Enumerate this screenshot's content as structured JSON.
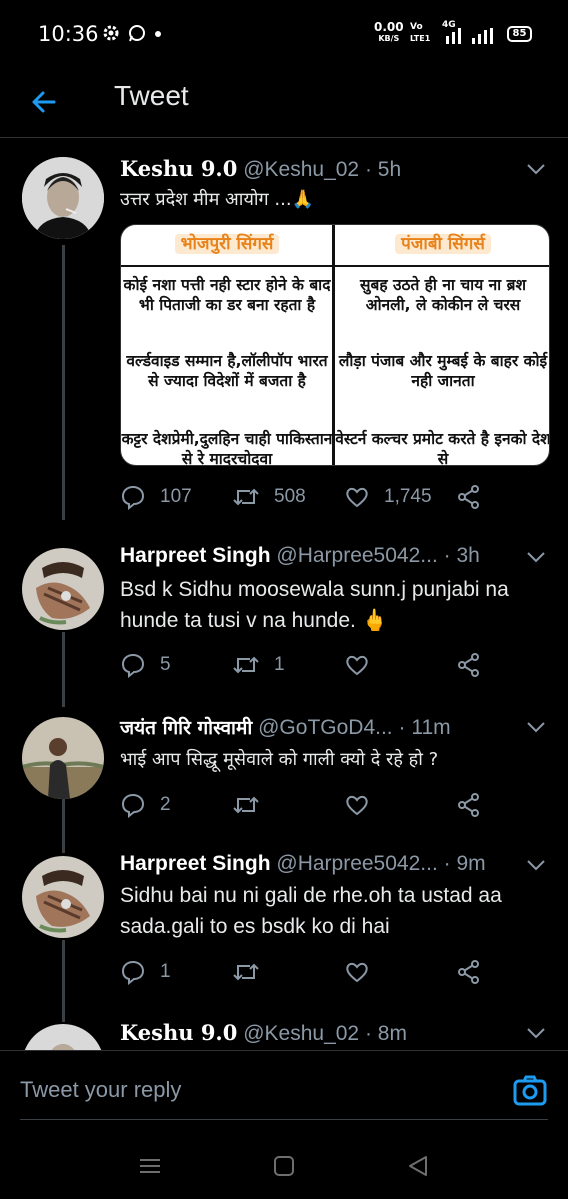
{
  "status_bar": {
    "time": "10:36",
    "net_speed_value": "0.00",
    "net_speed_unit": "KB/S",
    "volte_top": "Vo",
    "volte_bottom": "LTE1",
    "network_label": "4G",
    "battery": "85",
    "icons": [
      "gear-icon",
      "whatsapp-icon",
      "dot-icon",
      "signal-icon",
      "battery-icon"
    ]
  },
  "header": {
    "title": "Tweet",
    "back_icon": "arrow-left-icon"
  },
  "colors": {
    "accent": "#1d9bf0",
    "muted": "#8b98a5",
    "divider": "#2f3336",
    "background": "#000000"
  },
  "tweets": [
    {
      "name": "Keshu 9.0",
      "handle": "@Keshu_02",
      "sep": "·",
      "time": "5h",
      "text": "उत्तर प्रदेश मीम आयोग ...🙏",
      "media": {
        "left_title": "भोजपुरी सिंगर्स",
        "right_title": "पंजाबी सिंगर्स",
        "left_paragraphs": [
          "कोई नशा पत्ती नही स्टार होने के बाद भी पिताजी का डर बना रहता है",
          "वर्ल्डवाइड सम्मान है,लॉलीपॉप भारत से ज्यादा विदेशों में बजता है",
          "कट्टर देशप्रेमी,दुलहिन चाही पाकिस्तान से रे मादरचोदवा"
        ],
        "right_paragraphs": [
          "सुबह उठते ही ना चाय ना ब्रश ओनली, ले कोकीन ले चरस",
          "लौड़ा पंजाब और मुम्बई के बाहर कोई नही जानता",
          "वेस्टर्न कल्चर प्रमोट करते है इनको देश से"
        ]
      },
      "replies": "107",
      "retweets": "508",
      "likes": "1,745"
    },
    {
      "name": "Harpreet Singh",
      "handle": "@Harpree5042...",
      "sep": "·",
      "time": "3h",
      "text": "Bsd k Sidhu moosewala sunn.j punjabi na hunde ta tusi v na hunde. 🖕",
      "replies": "5",
      "retweets": "1",
      "likes": ""
    },
    {
      "name": "जयंत गिरि गोस्वामी",
      "handle": "@GoTGoD4...",
      "sep": "·",
      "time": "11m",
      "text": "भाई आप सिद्धू मूसेवाले को गाली क्यो दे रहे हो ?",
      "replies": "2",
      "retweets": "",
      "likes": ""
    },
    {
      "name": "Harpreet Singh",
      "handle": "@Harpree5042...",
      "sep": "·",
      "time": "9m",
      "text": "Sidhu bai nu ni gali de rhe.oh ta ustad aa sada.gali to es bsdk ko di hai",
      "replies": "1",
      "retweets": "",
      "likes": ""
    },
    {
      "name": "Keshu 9.0",
      "handle": "@Keshu_02",
      "sep": "·",
      "time": "8m"
    }
  ],
  "reply_bar": {
    "placeholder": "Tweet your reply",
    "camera_icon": "camera-icon"
  },
  "nav_bar": {
    "icons": [
      "menu-icon",
      "home-square-icon",
      "back-triangle-icon"
    ]
  }
}
